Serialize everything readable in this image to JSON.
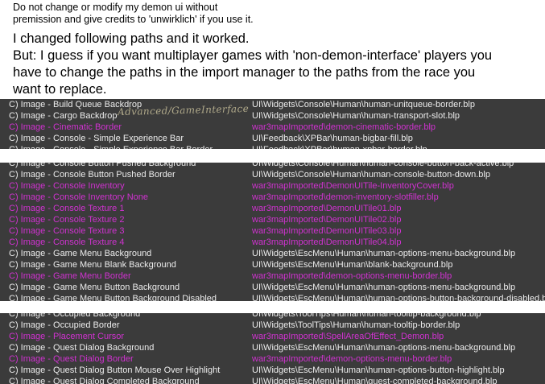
{
  "intro": {
    "note_line1": "Do not change or modify my demon ui without",
    "note_line2": "premission and give credits to 'unwirklich' if you use it.",
    "main_line1": "I changed following paths and it worked.",
    "main_line2": "But: I guess if you want multiplayer games with 'non-demon-interface' players you",
    "main_line3": "have to change the paths in the import manager to the paths from the race you",
    "main_line4": "want to replace."
  },
  "panel1": {
    "annotation": "Advanced/GameInterface",
    "rows": [
      {
        "name": "C) Image - Build Queue Backdrop",
        "path": "UI\\Widgets\\Console\\Human\\human-unitqueue-border.blp",
        "hl": false
      },
      {
        "name": "C) Image - Cargo Backdrop",
        "path": "UI\\Widgets\\Console\\Human\\human-transport-slot.blp",
        "hl": false
      },
      {
        "name": "C) Image - Cinematic Border",
        "path": "war3mapImported\\demon-cinematic-border.blp",
        "hl": true
      },
      {
        "name": "C) Image - Console - Simple Experience Bar",
        "path": "UI\\Feedback\\XPBar\\human-bigbar-fill.blp",
        "hl": false
      },
      {
        "name": "C) Image - Console - Simple Experience Bar Border",
        "path": "UI\\Feedback\\XPBar\\human-xpbar-border.blp",
        "hl": false
      }
    ]
  },
  "panel2": {
    "rows": [
      {
        "name": "C) Image - Console Button Pushed Background",
        "path": "UI\\Widgets\\Console\\Human\\human-console-button-back-active.blp",
        "hl": false
      },
      {
        "name": "C) Image - Console Button Pushed Border",
        "path": "UI\\Widgets\\Console\\Human\\human-console-button-down.blp",
        "hl": false
      },
      {
        "name": "C) Image - Console Inventory",
        "path": "war3mapImported\\DemonUITile-InventoryCover.blp",
        "hl": true
      },
      {
        "name": "C) Image - Console Inventory None",
        "path": "war3mapImported\\demon-inventory-slotfiller.blp",
        "hl": true
      },
      {
        "name": "C) Image - Console Texture 1",
        "path": "war3mapImported\\DemonUITile01.blp",
        "hl": true
      },
      {
        "name": "C) Image - Console Texture 2",
        "path": "war3mapImported\\DemonUITile02.blp",
        "hl": true
      },
      {
        "name": "C) Image - Console Texture 3",
        "path": "war3mapImported\\DemonUITile03.blp",
        "hl": true
      },
      {
        "name": "C) Image - Console Texture 4",
        "path": "war3mapImported\\DemonUITile04.blp",
        "hl": true
      },
      {
        "name": "C) Image - Game Menu Background",
        "path": "UI\\Widgets\\EscMenu\\Human\\human-options-menu-background.blp",
        "hl": false
      },
      {
        "name": "C) Image - Game Menu Blank Background",
        "path": "UI\\Widgets\\EscMenu\\Human\\blank-background.blp",
        "hl": false
      },
      {
        "name": "C) Image - Game Menu Border",
        "path": "war3mapImported\\demon-options-menu-border.blp",
        "hl": true
      },
      {
        "name": "C) Image - Game Menu Button Background",
        "path": "UI\\Widgets\\EscMenu\\Human\\human-options-menu-background.blp",
        "hl": false
      },
      {
        "name": "C) Image - Game Menu Button Background Disabled",
        "path": "UI\\Widgets\\EscMenu\\Human\\human-options-button-background-disabled.blp",
        "hl": false
      }
    ]
  },
  "panel3": {
    "rows": [
      {
        "name": "C) Image - Occupied Background",
        "path": "UI\\Widgets\\ToolTips\\Human\\human-tooltip-background.blp",
        "hl": false
      },
      {
        "name": "C) Image - Occupied Border",
        "path": "UI\\Widgets\\ToolTips\\Human\\human-tooltip-border.blp",
        "hl": false
      },
      {
        "name": "C) Image - Placement Cursor",
        "path": "war3mapImported\\SpellAreaOfEffect_Demon.blp",
        "hl": true
      },
      {
        "name": "C) Image - Quest Dialog Background",
        "path": "UI\\Widgets\\EscMenu\\Human\\human-options-menu-background.blp",
        "hl": false
      },
      {
        "name": "C) Image - Quest Dialog Border",
        "path": "war3mapImported\\demon-options-menu-border.blp",
        "hl": true
      },
      {
        "name": "C) Image - Quest Dialog Button Mouse Over Highlight",
        "path": "UI\\Widgets\\EscMenu\\Human\\human-options-button-highlight.blp",
        "hl": false
      },
      {
        "name": "C) Image - Quest Dialog Completed Background",
        "path": "UI\\Widgets\\EscMenu\\Human\\quest-completed-background.blp",
        "hl": false
      }
    ]
  }
}
